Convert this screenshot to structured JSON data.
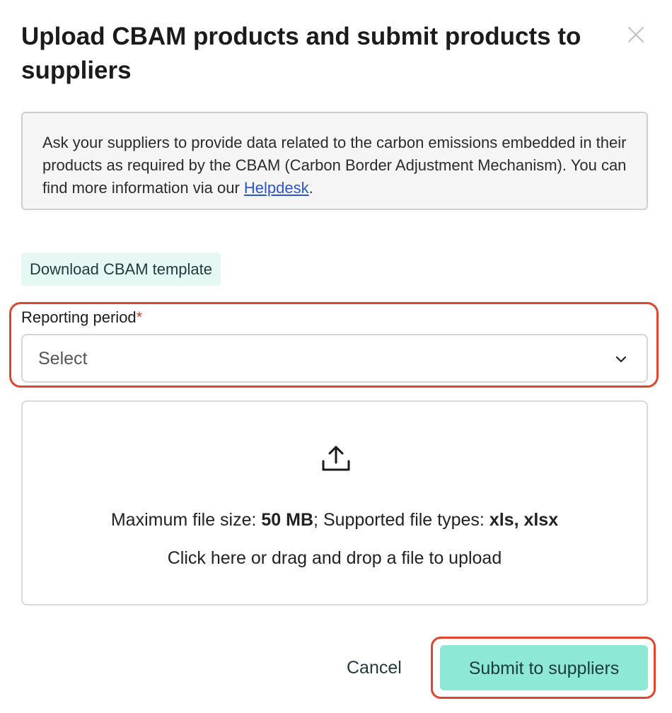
{
  "modal": {
    "title": "Upload CBAM products and submit products to suppliers",
    "close_icon": "close-icon"
  },
  "info": {
    "text": "Ask your suppliers to provide data related to the carbon emissions embedded in their products as required by the CBAM (Carbon Border Adjustment Mechanism). You can find more information via our ",
    "link_label": "Helpdesk",
    "suffix": "."
  },
  "download": {
    "label": "Download CBAM template"
  },
  "reporting_period": {
    "label": "Reporting period",
    "required_mark": "*",
    "placeholder": "Select",
    "icon": "chevron-down-icon"
  },
  "dropzone": {
    "icon": "upload-icon",
    "max_size_label": "Maximum file size: ",
    "max_size_value": "50 MB",
    "types_label": "; Supported file types: ",
    "types_value": "xls, xlsx",
    "hint": "Click here or drag and drop a file to upload"
  },
  "actions": {
    "cancel_label": "Cancel",
    "submit_label": "Submit to suppliers"
  },
  "colors": {
    "primary": "#8de8d6",
    "download_bg": "#e6f8f4",
    "highlight": "#e0452d",
    "link": "#2a55d6",
    "required": "#d93a2b"
  }
}
